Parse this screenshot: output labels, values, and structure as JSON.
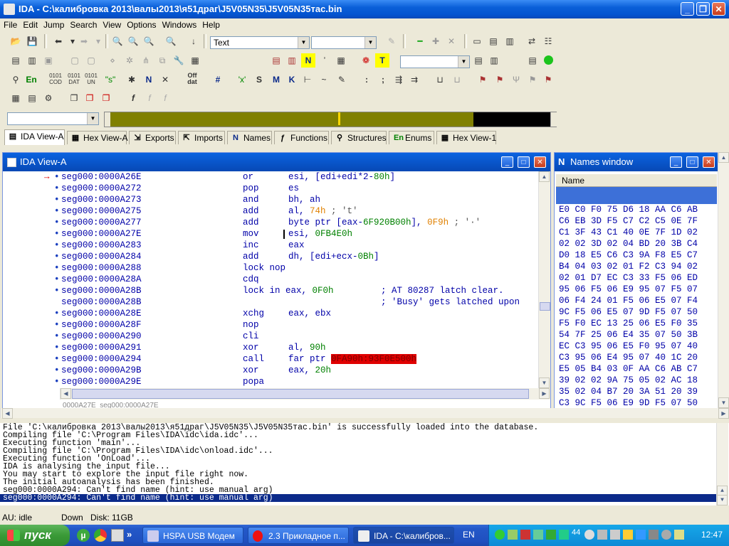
{
  "window": {
    "title": "IDA - C:\\калибровка 2013\\валы2013\\я51драг\\J5V05N35\\J5V05N35тас.bin",
    "controls": [
      "_",
      "❐",
      "✕"
    ]
  },
  "menu": [
    "File",
    "Edit",
    "Jump",
    "Search",
    "View",
    "Options",
    "Windows",
    "Help"
  ],
  "toolbar": {
    "view_combo": "Text",
    "second_combo": "",
    "third_combo": "",
    "segment_combo": ""
  },
  "tabs": [
    {
      "label": "IDA View-A",
      "icon": "ida-view-icon",
      "glyph": "▤"
    },
    {
      "label": "Hex View-A",
      "icon": "hex-view-icon",
      "glyph": "▦"
    },
    {
      "label": "Exports",
      "icon": "exports-icon",
      "glyph": "⇲"
    },
    {
      "label": "Imports",
      "icon": "imports-icon",
      "glyph": "⇱"
    },
    {
      "label": "Names",
      "icon": "names-icon",
      "glyph": "N"
    },
    {
      "label": "Functions",
      "icon": "functions-icon",
      "glyph": "ƒ"
    },
    {
      "label": "Structures",
      "icon": "structures-icon",
      "glyph": "⚲"
    },
    {
      "label": "Enums",
      "icon": "enums-icon",
      "glyph": "En"
    },
    {
      "label": "Hex View-1",
      "icon": "hex-view-icon",
      "glyph": "▦"
    }
  ],
  "ida_view": {
    "title": "IDA View-A",
    "lines": [
      {
        "addr": "seg000:0000A26E",
        "mn": "or",
        "op": "esi, [edi+edi*2-80h]",
        "arrow": true
      },
      {
        "addr": "seg000:0000A272",
        "mn": "pop",
        "op": "es"
      },
      {
        "addr": "seg000:0000A273",
        "mn": "and",
        "op": "bh, ah"
      },
      {
        "addr": "seg000:0000A275",
        "mn": "add",
        "op": "al, 74h ; 't'"
      },
      {
        "addr": "seg000:0000A277",
        "mn": "add",
        "op": "byte ptr [eax-6F920B00h], 0F9h ; '·'"
      },
      {
        "addr": "seg000:0000A27E",
        "mn": "mov",
        "op": "esi, 0FB4E0h"
      },
      {
        "addr": "seg000:0000A283",
        "mn": "inc",
        "op": "eax"
      },
      {
        "addr": "seg000:0000A284",
        "mn": "add",
        "op": "dh, [edi+ecx-0Bh]"
      },
      {
        "addr": "seg000:0000A288",
        "mn": "lock nop",
        "op": ""
      },
      {
        "addr": "seg000:0000A28A",
        "mn": "cdq",
        "op": ""
      },
      {
        "addr": "seg000:0000A28B",
        "mn": "lock in eax, 0F0h",
        "op": "",
        "comment": "; AT 80287 latch clear."
      },
      {
        "addr": "seg000:0000A28B",
        "mn": "",
        "op": "",
        "comment": "; 'Busy' gets latched upon",
        "nobullet": true
      },
      {
        "addr": "seg000:0000A28E",
        "mn": "xchg",
        "op": "eax, ebx"
      },
      {
        "addr": "seg000:0000A28F",
        "mn": "nop",
        "op": ""
      },
      {
        "addr": "seg000:0000A290",
        "mn": "cli",
        "op": ""
      },
      {
        "addr": "seg000:0000A291",
        "mn": "xor",
        "op": "al, 90h"
      },
      {
        "addr": "seg000:0000A294",
        "mn": "call",
        "op": "far ptr 0FA90h:93F0E500h"
      },
      {
        "addr": "seg000:0000A29B",
        "mn": "xor",
        "op": "eax, 20h"
      },
      {
        "addr": "seg000:0000A29E",
        "mn": "popa",
        "op": ""
      }
    ],
    "footer": "0000A27E  seg000:0000A27E"
  },
  "names_window": {
    "title": "Names window",
    "column": "Name",
    "hex_lines": [
      "E0 C0 F0 75 D6 18 AA C6 AB",
      "C6 EB 3D F5 C7 C2 C5 0E 7F",
      "C1 3F 43 C1 40 0E 7F 1D 02",
      "02 02 3D 02 04 BD 20 3B C4",
      "D0 18 E5 C6 C3 9A F8 E5 C7",
      "B4 04 03 02 01 F2 C3 94 02",
      "02 01 D7 EC C3 33 F5 06 ED",
      "95 06 F5 06 E9 95 07 F5 07",
      "06 F4 24 01 F5 06 E5 07 F4",
      "9C F5 06 E5 07 9D F5 07 50",
      "F5 F0 EC 13 25 06 E5 F0 35",
      "54 7F 25 06 E4 35 07 50 3B",
      "EC C3 95 06 E5 F0 95 07 40",
      "C3 95 06 E4 95 07 40 1C 20",
      "E5 05 B4 03 0F AA C6 AB C7",
      "39 02 02 9A 75 05 02 AC 18",
      "35 02 04 B7 20 3A 51 20 39",
      "C3 9C F5 06 E9 9D F5 07 50"
    ]
  },
  "output": {
    "lines": [
      "File 'C:\\калибровка 2013\\валы2013\\я51драг\\J5V05N35\\J5V05N35тас.bin' is successfully loaded into the database.",
      "Compiling file 'C:\\Program Files\\IDA\\idc\\ida.idc'...",
      "Executing function 'main'...",
      "Compiling file 'C:\\Program Files\\IDA\\idc\\onload.idc'...",
      "Executing function 'OnLoad'...",
      "IDA is analysing the input file...",
      "You may start to explore the input file right now.",
      "The initial autoanalysis has been finished.",
      "seg000:0000A294: Can't find name (hint: use manual arg)",
      "seg000:0000A294: Can't find name (hint: use manual arg)"
    ]
  },
  "status": {
    "au": "AU: idle",
    "dir": "Down",
    "disk": "Disk: 11GB"
  },
  "taskbar": {
    "start": "пуск",
    "tasks": [
      "HSPA USB Модем",
      "2.3 Прикладное п...",
      "IDA - C:\\калибров..."
    ],
    "lang": "EN",
    "tray_count": "44",
    "clock": "12:47"
  },
  "colors": {
    "accent": "#0a5fd8",
    "nav_band": "#808000",
    "highlight": "#e00000",
    "selection": "#0b2a8a"
  }
}
